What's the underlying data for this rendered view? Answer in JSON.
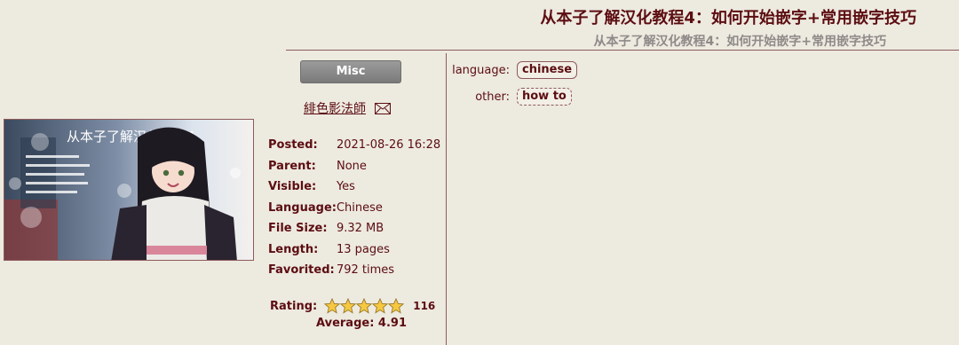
{
  "gallery": {
    "title": "从本子了解汉化教程4：如何开始嵌字+常用嵌字技巧",
    "title_jp": "从本子了解汉化教程4：如何开始嵌字+常用嵌字技巧",
    "category": "Misc",
    "uploader": "緋色影法師",
    "cover_text": "从本子了解汉化教程4"
  },
  "meta": [
    {
      "key": "Posted:",
      "value": "2021-08-26 16:28"
    },
    {
      "key": "Parent:",
      "value": "None"
    },
    {
      "key": "Visible:",
      "value": "Yes"
    },
    {
      "key": "Language:",
      "value": "Chinese"
    },
    {
      "key": "File Size:",
      "value": "9.32 MB"
    },
    {
      "key": "Length:",
      "value": "13 pages"
    },
    {
      "key": "Favorited:",
      "value": "792 times"
    }
  ],
  "rating": {
    "label": "Rating:",
    "count": "116",
    "average": "Average: 4.91",
    "stars_filled": 5
  },
  "tags": [
    {
      "namespace": "language:",
      "tags": [
        "chinese"
      ]
    },
    {
      "namespace": "other:",
      "tags": [
        "how to"
      ]
    }
  ],
  "colors": {
    "background": "#EDEAE0",
    "text": "#5C0D11",
    "border": "#8D5B5B",
    "star": "#F5C842"
  }
}
